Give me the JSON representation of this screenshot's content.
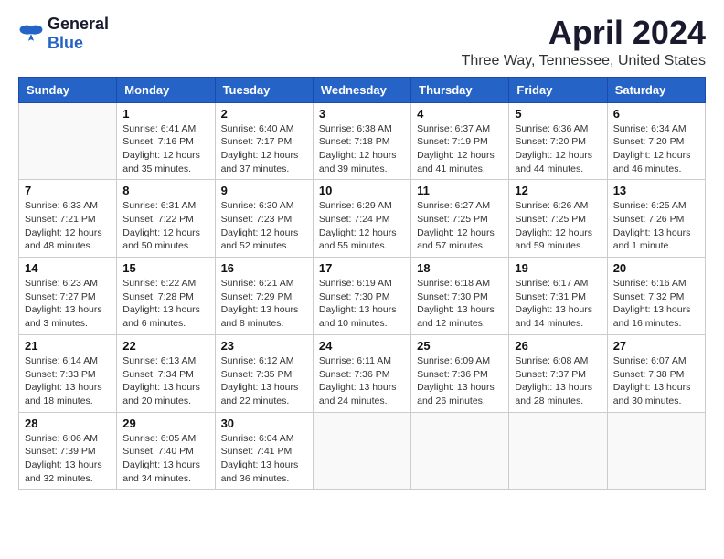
{
  "header": {
    "logo_general": "General",
    "logo_blue": "Blue",
    "month": "April 2024",
    "location": "Three Way, Tennessee, United States"
  },
  "days_of_week": [
    "Sunday",
    "Monday",
    "Tuesday",
    "Wednesday",
    "Thursday",
    "Friday",
    "Saturday"
  ],
  "weeks": [
    [
      {
        "day": "",
        "info": ""
      },
      {
        "day": "1",
        "info": "Sunrise: 6:41 AM\nSunset: 7:16 PM\nDaylight: 12 hours\nand 35 minutes."
      },
      {
        "day": "2",
        "info": "Sunrise: 6:40 AM\nSunset: 7:17 PM\nDaylight: 12 hours\nand 37 minutes."
      },
      {
        "day": "3",
        "info": "Sunrise: 6:38 AM\nSunset: 7:18 PM\nDaylight: 12 hours\nand 39 minutes."
      },
      {
        "day": "4",
        "info": "Sunrise: 6:37 AM\nSunset: 7:19 PM\nDaylight: 12 hours\nand 41 minutes."
      },
      {
        "day": "5",
        "info": "Sunrise: 6:36 AM\nSunset: 7:20 PM\nDaylight: 12 hours\nand 44 minutes."
      },
      {
        "day": "6",
        "info": "Sunrise: 6:34 AM\nSunset: 7:20 PM\nDaylight: 12 hours\nand 46 minutes."
      }
    ],
    [
      {
        "day": "7",
        "info": "Sunrise: 6:33 AM\nSunset: 7:21 PM\nDaylight: 12 hours\nand 48 minutes."
      },
      {
        "day": "8",
        "info": "Sunrise: 6:31 AM\nSunset: 7:22 PM\nDaylight: 12 hours\nand 50 minutes."
      },
      {
        "day": "9",
        "info": "Sunrise: 6:30 AM\nSunset: 7:23 PM\nDaylight: 12 hours\nand 52 minutes."
      },
      {
        "day": "10",
        "info": "Sunrise: 6:29 AM\nSunset: 7:24 PM\nDaylight: 12 hours\nand 55 minutes."
      },
      {
        "day": "11",
        "info": "Sunrise: 6:27 AM\nSunset: 7:25 PM\nDaylight: 12 hours\nand 57 minutes."
      },
      {
        "day": "12",
        "info": "Sunrise: 6:26 AM\nSunset: 7:25 PM\nDaylight: 12 hours\nand 59 minutes."
      },
      {
        "day": "13",
        "info": "Sunrise: 6:25 AM\nSunset: 7:26 PM\nDaylight: 13 hours\nand 1 minute."
      }
    ],
    [
      {
        "day": "14",
        "info": "Sunrise: 6:23 AM\nSunset: 7:27 PM\nDaylight: 13 hours\nand 3 minutes."
      },
      {
        "day": "15",
        "info": "Sunrise: 6:22 AM\nSunset: 7:28 PM\nDaylight: 13 hours\nand 6 minutes."
      },
      {
        "day": "16",
        "info": "Sunrise: 6:21 AM\nSunset: 7:29 PM\nDaylight: 13 hours\nand 8 minutes."
      },
      {
        "day": "17",
        "info": "Sunrise: 6:19 AM\nSunset: 7:30 PM\nDaylight: 13 hours\nand 10 minutes."
      },
      {
        "day": "18",
        "info": "Sunrise: 6:18 AM\nSunset: 7:30 PM\nDaylight: 13 hours\nand 12 minutes."
      },
      {
        "day": "19",
        "info": "Sunrise: 6:17 AM\nSunset: 7:31 PM\nDaylight: 13 hours\nand 14 minutes."
      },
      {
        "day": "20",
        "info": "Sunrise: 6:16 AM\nSunset: 7:32 PM\nDaylight: 13 hours\nand 16 minutes."
      }
    ],
    [
      {
        "day": "21",
        "info": "Sunrise: 6:14 AM\nSunset: 7:33 PM\nDaylight: 13 hours\nand 18 minutes."
      },
      {
        "day": "22",
        "info": "Sunrise: 6:13 AM\nSunset: 7:34 PM\nDaylight: 13 hours\nand 20 minutes."
      },
      {
        "day": "23",
        "info": "Sunrise: 6:12 AM\nSunset: 7:35 PM\nDaylight: 13 hours\nand 22 minutes."
      },
      {
        "day": "24",
        "info": "Sunrise: 6:11 AM\nSunset: 7:36 PM\nDaylight: 13 hours\nand 24 minutes."
      },
      {
        "day": "25",
        "info": "Sunrise: 6:09 AM\nSunset: 7:36 PM\nDaylight: 13 hours\nand 26 minutes."
      },
      {
        "day": "26",
        "info": "Sunrise: 6:08 AM\nSunset: 7:37 PM\nDaylight: 13 hours\nand 28 minutes."
      },
      {
        "day": "27",
        "info": "Sunrise: 6:07 AM\nSunset: 7:38 PM\nDaylight: 13 hours\nand 30 minutes."
      }
    ],
    [
      {
        "day": "28",
        "info": "Sunrise: 6:06 AM\nSunset: 7:39 PM\nDaylight: 13 hours\nand 32 minutes."
      },
      {
        "day": "29",
        "info": "Sunrise: 6:05 AM\nSunset: 7:40 PM\nDaylight: 13 hours\nand 34 minutes."
      },
      {
        "day": "30",
        "info": "Sunrise: 6:04 AM\nSunset: 7:41 PM\nDaylight: 13 hours\nand 36 minutes."
      },
      {
        "day": "",
        "info": ""
      },
      {
        "day": "",
        "info": ""
      },
      {
        "day": "",
        "info": ""
      },
      {
        "day": "",
        "info": ""
      }
    ]
  ]
}
